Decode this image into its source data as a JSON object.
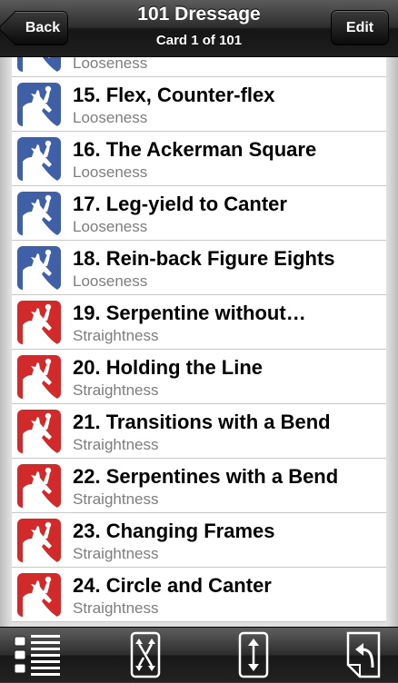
{
  "nav": {
    "title": "101 Dressage",
    "subtitle": "Card 1 of 101",
    "back_label": "Back",
    "edit_label": "Edit"
  },
  "colors": {
    "looseness": "#3f5fa6",
    "straightness": "#d22a2a"
  },
  "list": {
    "items": [
      {
        "title": "",
        "category": "Looseness",
        "color": "looseness"
      },
      {
        "title": "15. Flex, Counter-flex",
        "category": "Looseness",
        "color": "looseness"
      },
      {
        "title": "16. The Ackerman Square",
        "category": "Looseness",
        "color": "looseness"
      },
      {
        "title": "17. Leg-yield to Canter",
        "category": "Looseness",
        "color": "looseness"
      },
      {
        "title": "18. Rein-back Figure Eights",
        "category": "Looseness",
        "color": "looseness"
      },
      {
        "title": "19. Serpentine without…",
        "category": "Straightness",
        "color": "straightness"
      },
      {
        "title": "20. Holding the Line",
        "category": "Straightness",
        "color": "straightness"
      },
      {
        "title": "21. Transitions with a Bend",
        "category": "Straightness",
        "color": "straightness"
      },
      {
        "title": "22. Serpentines with a Bend",
        "category": "Straightness",
        "color": "straightness"
      },
      {
        "title": "23. Changing Frames",
        "category": "Straightness",
        "color": "straightness"
      },
      {
        "title": "24. Circle and Canter",
        "category": "Straightness",
        "color": "straightness"
      }
    ]
  },
  "toolbar": {
    "icons": [
      "list-view-icon",
      "shuffle-icon",
      "sort-icon",
      "card-flip-icon"
    ]
  }
}
